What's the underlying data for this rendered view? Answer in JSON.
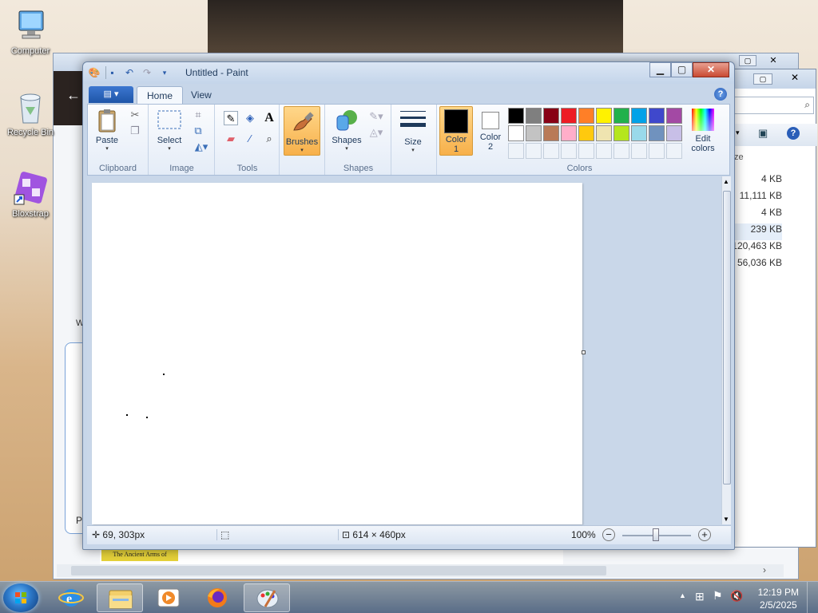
{
  "desktop": {
    "icons": [
      {
        "label": "Computer",
        "icon": "computer-icon"
      },
      {
        "label": "Recycle Bin",
        "icon": "recycle-bin-icon"
      },
      {
        "label": "Bloxstrap",
        "icon": "bloxstrap-icon"
      }
    ]
  },
  "explorer_bg": {
    "sizes": [
      "4 KB",
      "11,111 KB",
      "4 KB",
      "239 KB",
      "120,463 KB",
      "56,036 KB"
    ],
    "size_header": "ze",
    "partial_texts": [
      "W",
      "P",
      "The Ancient Arms of"
    ]
  },
  "paint": {
    "title": "Untitled - Paint",
    "tabs": {
      "file": "▤ ▾",
      "home": "Home",
      "view": "View"
    },
    "help": "?",
    "clipboard": {
      "group": "Clipboard",
      "paste": "Paste"
    },
    "image": {
      "group": "Image",
      "select": "Select"
    },
    "tools": {
      "group": "Tools"
    },
    "brushes": {
      "label": "Brushes"
    },
    "shapes": {
      "group": "Shapes",
      "label": "Shapes"
    },
    "size": {
      "label": "Size"
    },
    "colors": {
      "group": "Colors",
      "color1": "Color\n1",
      "color1_line1": "Color",
      "color1_line2": "1",
      "color2_line1": "Color",
      "color2_line2": "2",
      "edit_line1": "Edit",
      "edit_line2": "colors",
      "color1_value": "#000000",
      "color2_value": "#ffffff",
      "palette_row1": [
        "#000000",
        "#7f7f7f",
        "#880015",
        "#ed1c24",
        "#ff7f27",
        "#fff200",
        "#22b14c",
        "#00a2e8",
        "#3f48cc",
        "#a349a4"
      ],
      "palette_row2": [
        "#ffffff",
        "#c3c3c3",
        "#b97a57",
        "#ffaec9",
        "#ffc90e",
        "#efe4b0",
        "#b5e61d",
        "#99d9ea",
        "#7092be",
        "#c8bfe7"
      ]
    },
    "status": {
      "cursor": "69, 303px",
      "canvas_size": "614 × 460px",
      "zoom": "100%"
    }
  },
  "taskbar": {
    "clock_time": "12:19 PM",
    "clock_date": "2/5/2025"
  }
}
